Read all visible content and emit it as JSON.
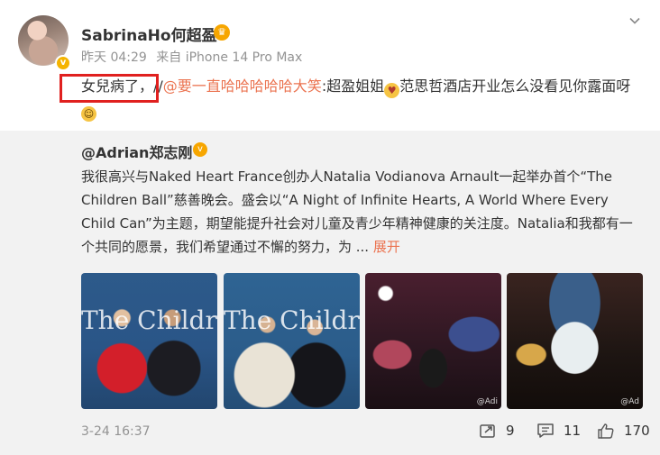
{
  "post": {
    "author": "SabrinaHo何超盈",
    "time": "昨天 04:29",
    "source": "来自 iPhone 14 Pro Max",
    "text_prefix": "女兒病了，",
    "repost_sep": "//",
    "mention": "@要一直哈哈哈哈哈大笑",
    "text_after_mention": ":超盈姐姐",
    "text_after_emoji": "范思哲酒店开业怎么没看见你露面呀"
  },
  "repost": {
    "author": "@Adrian郑志刚",
    "text": "我很高兴与Naked Heart France创办人Natalia Vodianova Arnault一起举办首个“The Children Ball”慈善晚会。盛会以“A Night of Infinite Hearts, A World Where Every Child Can”为主题，期望能提升社会对儿童及青少年精神健康的关注度。Natalia和我都有一个共同的愿景，我们希望通过不懈的努力，为 ...",
    "expand_label": "展开",
    "photos": [
      {
        "overlay_text": "The Children",
        "watermark": ""
      },
      {
        "overlay_text": "The Children",
        "watermark": ""
      },
      {
        "overlay_text": "",
        "watermark": "@Adi"
      },
      {
        "overlay_text": "",
        "watermark": "@Ad"
      }
    ],
    "time": "3-24 16:37",
    "reposts": "9",
    "comments": "11",
    "likes": "170"
  },
  "colors": {
    "link": "#eb7350",
    "meta": "#939393",
    "highlight": "#e0201f",
    "verified": "#f7a600"
  },
  "icons": [
    "chevron-down-icon",
    "verified-badge-icon",
    "kiss-emoji-icon",
    "grin-emoji-icon",
    "repost-icon",
    "comment-icon",
    "like-icon"
  ]
}
